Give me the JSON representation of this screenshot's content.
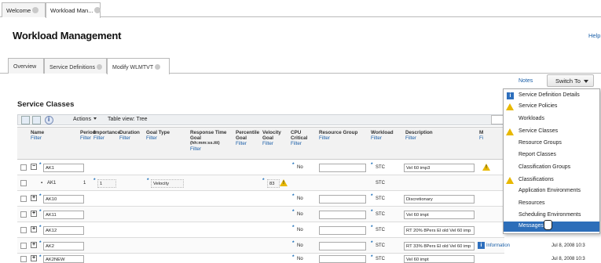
{
  "top_tabs": [
    {
      "label": "Welcome"
    },
    {
      "label": "Workload Man..."
    }
  ],
  "page_title": "Workload Management",
  "help_label": "Help",
  "tabs": [
    {
      "label": "Overview"
    },
    {
      "label": "Service Definitions"
    },
    {
      "label": "Modify WLMTVT"
    }
  ],
  "notes_label": "Notes",
  "switch_to_label": "Switch To",
  "section_title": "Service Classes",
  "toolbar": {
    "actions_label": "Actions",
    "table_view_label": "Table view: Tree"
  },
  "columns": [
    {
      "label": "Name",
      "filter": "Filter"
    },
    {
      "label": "Period",
      "filter": "Filter"
    },
    {
      "label": "Importance",
      "filter": "Filter"
    },
    {
      "label": "Duration",
      "filter": "Filter"
    },
    {
      "label": "Goal Type",
      "filter": "Filter"
    },
    {
      "label": "Response Time Goal",
      "sub": "(hh:mm:ss.ttt)",
      "filter": "Filter"
    },
    {
      "label": "Percentile Goal",
      "filter": "Filter"
    },
    {
      "label": "Velocity Goal",
      "filter": "Filter"
    },
    {
      "label": "CPU Critical",
      "filter": "Filter"
    },
    {
      "label": "Resource Group",
      "filter": "Filter"
    },
    {
      "label": "Workload",
      "filter": "Filter"
    },
    {
      "label": "Description",
      "filter": "Filter"
    },
    {
      "label": "M",
      "filter": "Fi"
    }
  ],
  "rows": [
    {
      "name": "AK1",
      "cpu": "No",
      "workload": "STC",
      "description": "Vel 60 imp3"
    },
    {
      "name": "AK1",
      "period": "1",
      "importance": "1",
      "goal_type": "Velocity",
      "velocity": "83",
      "workload": "STC"
    },
    {
      "name": "AK10",
      "cpu": "No",
      "workload": "STC",
      "description": "Discretionary"
    },
    {
      "name": "AK11",
      "cpu": "No",
      "workload": "STC",
      "description": "Vel 60 impt"
    },
    {
      "name": "AK12",
      "cpu": "No",
      "workload": "STC",
      "description": "RT 20% 8Pers El old Vel 60 imp"
    },
    {
      "name": "AK2",
      "cpu": "No",
      "workload": "STC",
      "description": "RT 33% 8Pers El old Vel 60 imp",
      "message": "Information",
      "date": "Jul 8, 2008 10:3"
    },
    {
      "name": "AK2NEW",
      "cpu": "No",
      "workload": "STC",
      "description": "Vel 60 impt",
      "date": "Jul 8, 2008 10:3"
    }
  ],
  "menu": [
    {
      "label": "Service Definition Details",
      "icon": "info-icon"
    },
    {
      "label": "Service Policies",
      "icon": "warning-icon"
    },
    {
      "label": "Workloads",
      "icon": ""
    },
    {
      "label": "Service Classes",
      "icon": "warning-icon"
    },
    {
      "label": "Resource Groups",
      "icon": ""
    },
    {
      "label": "Report Classes",
      "icon": ""
    },
    {
      "label": "Classification Groups",
      "icon": ""
    },
    {
      "label": "Classifications",
      "icon": "warning-icon"
    },
    {
      "label": "Application Environments",
      "icon": ""
    },
    {
      "label": "Resources",
      "icon": ""
    },
    {
      "label": "Scheduling Environments",
      "icon": ""
    },
    {
      "label": "Messages",
      "icon": ""
    }
  ],
  "colors": {
    "link": "#1a5fa8",
    "selected_menu": "#2d6eb9",
    "warning": "#e8b800",
    "info": "#2e6fbd"
  }
}
